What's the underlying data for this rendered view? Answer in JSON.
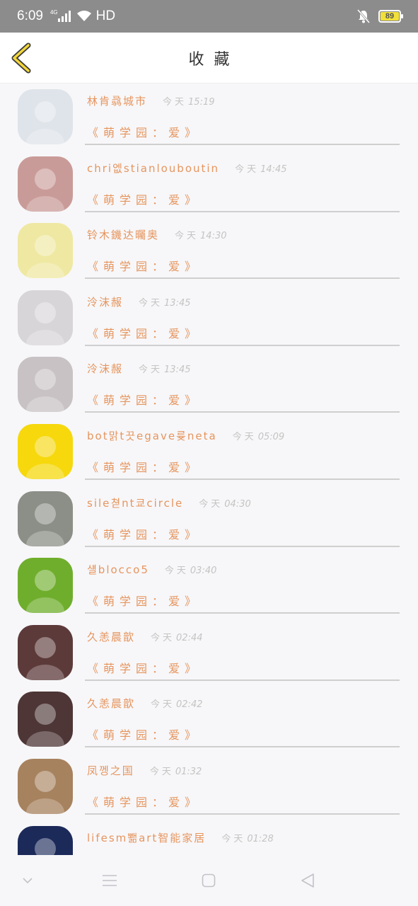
{
  "status": {
    "time": "6:09",
    "network": "4G",
    "hd": "HD",
    "battery": "89"
  },
  "header": {
    "title": "收藏"
  },
  "list_item_subtitle": "《萌学园：爱》",
  "items": [
    {
      "name": "林肯骉城市",
      "time_label": "今天",
      "time": "15:19",
      "avatar_color": "#dfe4ea"
    },
    {
      "name": "chri엢stianlouboutin",
      "time_label": "今天",
      "time": "14:45",
      "avatar_color": "#c99b98"
    },
    {
      "name": "铃木鐖达曯奥",
      "time_label": "今天",
      "time": "14:30",
      "avatar_color": "#efe8a2"
    },
    {
      "name": "泠沫赧",
      "time_label": "今天",
      "time": "13:45",
      "avatar_color": "#d8d5d8"
    },
    {
      "name": "泠沫赧",
      "time_label": "今天",
      "time": "13:45",
      "avatar_color": "#c8c2c4"
    },
    {
      "name": "bot맑t끗egave륮neta",
      "time_label": "今天",
      "time": "05:09",
      "avatar_color": "#f6d80d"
    },
    {
      "name": "sile쳗nt쿄circle",
      "time_label": "今天",
      "time": "04:30",
      "avatar_color": "#8c8f87"
    },
    {
      "name": "섈blocco5",
      "time_label": "今天",
      "time": "03:40",
      "avatar_color": "#6fae2c"
    },
    {
      "name": "久恙晨歆",
      "time_label": "今天",
      "time": "02:44",
      "avatar_color": "#5d3a3a"
    },
    {
      "name": "久恙晨歆",
      "time_label": "今天",
      "time": "02:42",
      "avatar_color": "#4e3636"
    },
    {
      "name": "凤껭之国",
      "time_label": "今天",
      "time": "01:32",
      "avatar_color": "#a7825e"
    },
    {
      "name": "lifesm뾂art智能家居",
      "time_label": "今天",
      "time": "01:28",
      "avatar_color": "#1c2a5a"
    }
  ]
}
